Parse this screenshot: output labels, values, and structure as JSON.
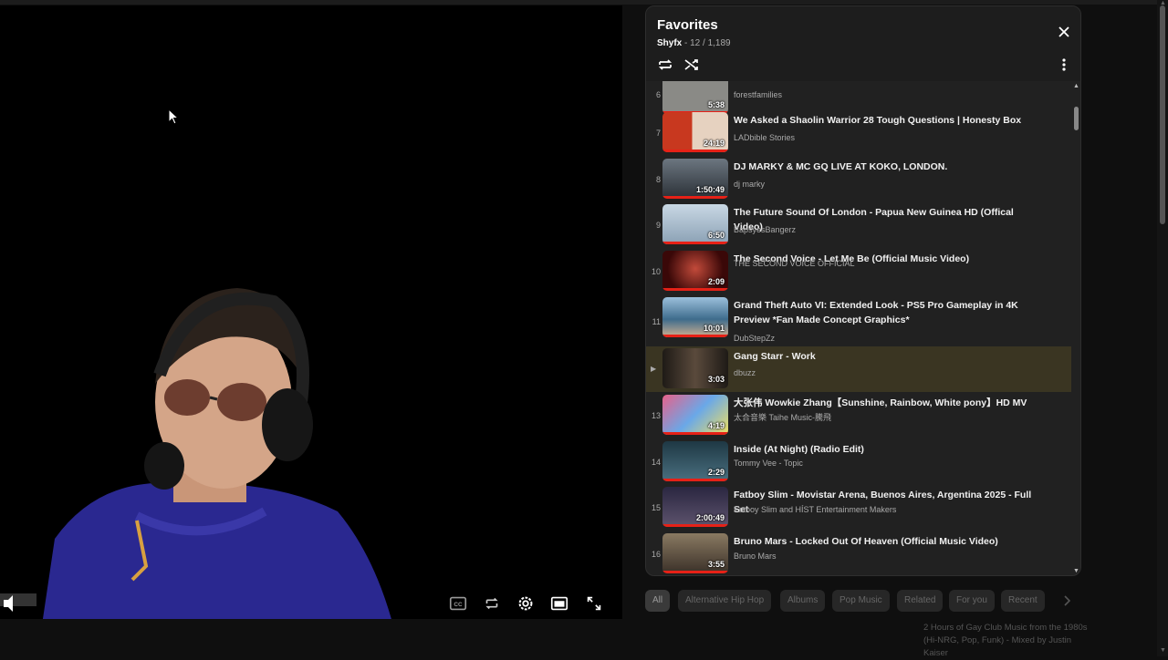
{
  "playlist": {
    "title": "Favorites",
    "owner": "Shyfx",
    "position": "12 / 1,189",
    "items": [
      {
        "index": "6",
        "title": "",
        "channel": "forestfamilies",
        "duration": "5:38",
        "thumb_color": "#8a8a86"
      },
      {
        "index": "7",
        "title": "We Asked a Shaolin Warrior 28 Tough Questions | Honesty Box",
        "channel": "LADbible Stories",
        "duration": "24:19",
        "thumb_color": "#b5321e"
      },
      {
        "index": "8",
        "title": "DJ MARKY & MC GQ LIVE AT KOKO, LONDON.",
        "channel": "dj marky",
        "duration": "1:50:49",
        "thumb_color": "#4a5560"
      },
      {
        "index": "9",
        "title": "The Future Sound Of London - Papua New Guinea HD (Offical Video)",
        "channel": "BapsyesBangerz",
        "duration": "6:50",
        "thumb_color": "#9eb4c4"
      },
      {
        "index": "10",
        "title": "The Second Voice - Let Me Be (Official Music Video)",
        "channel": "THE SECOND VOICE OFFICIAL",
        "duration": "2:09",
        "thumb_color": "#7a1414"
      },
      {
        "index": "11",
        "title": "Grand Theft Auto VI: Extended Look - PS5 Pro Gameplay in 4K Preview *Fan Made Concept Graphics*",
        "channel": "DubStepZz",
        "duration": "10:01",
        "thumb_color": "#4f7ea3"
      },
      {
        "index": "12",
        "title": "Gang Starr - Work",
        "channel": "dbuzz",
        "duration": "3:03",
        "thumb_color": "#3a3028"
      },
      {
        "index": "13",
        "title": "大张伟 Wowkie Zhang【Sunshine, Rainbow, White pony】HD MV",
        "channel": "太合音樂 Taihe Music-騰飛",
        "duration": "4:19",
        "thumb_color": "#c93d6a"
      },
      {
        "index": "14",
        "title": "Inside (At Night) (Radio Edit)",
        "channel": "Tommy Vee - Topic",
        "duration": "2:29",
        "thumb_color": "#27434f"
      },
      {
        "index": "15",
        "title": "Fatboy Slim - Movistar Arena, Buenos Aires, Argentina 2025 - Full Set",
        "channel": "Fatboy Slim and HÍST Entertainment Makers",
        "duration": "2:00:49",
        "thumb_color": "#3b3550"
      },
      {
        "index": "16",
        "title": "Bruno Mars - Locked Out Of Heaven (Official Music Video)",
        "channel": "Bruno Mars",
        "duration": "3:55",
        "thumb_color": "#6a5a48"
      }
    ]
  },
  "icons": {
    "close": "close-icon",
    "loop": "loop-icon",
    "shuffle": "shuffle-icon",
    "more": "more-vert-icon"
  },
  "chips": [
    "All",
    "Alternative Hip Hop",
    "Albums",
    "Pop Music",
    "Related",
    "For you",
    "Recent"
  ],
  "recommendation": {
    "text": "2 Hours of Gay Club Music from the 1980s (Hi-NRG, Pop, Funk) - Mixed by Justin Kaiser"
  },
  "colors": {
    "accent_red": "#e62117",
    "panel_bg": "#212121",
    "active_row": "#3a3522"
  }
}
